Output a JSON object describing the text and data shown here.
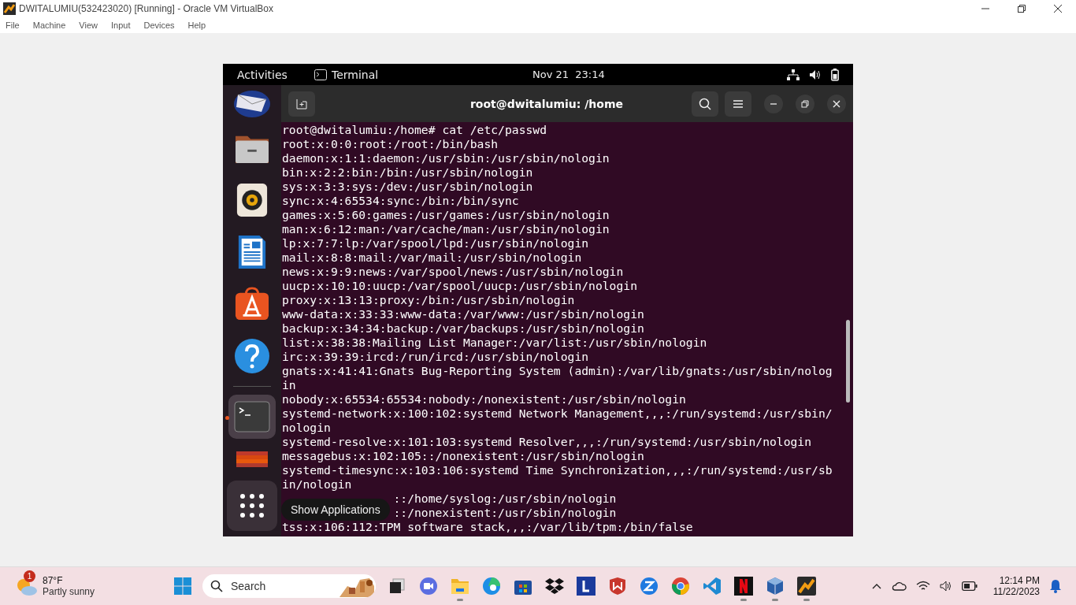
{
  "host_window": {
    "title": "DWITALUMIU(532423020) [Running] - Oracle VM VirtualBox",
    "menu": [
      "File",
      "Machine",
      "View",
      "Input",
      "Devices",
      "Help"
    ]
  },
  "guest": {
    "top_bar": {
      "activities": "Activities",
      "app": "Terminal",
      "clock": "Nov 21  23:14"
    },
    "dock": {
      "items": [
        {
          "kind": "mail",
          "active": false
        },
        {
          "kind": "files",
          "active": false
        },
        {
          "kind": "speaker",
          "active": false
        },
        {
          "kind": "document",
          "active": false
        },
        {
          "kind": "store",
          "active": false
        },
        {
          "kind": "help",
          "active": false
        },
        {
          "kind": "terminal",
          "active": true
        },
        {
          "kind": "stack",
          "active": false
        }
      ],
      "show_apps_tooltip": "Show Applications"
    },
    "terminal": {
      "title": "root@dwitalumiu: /home",
      "lines": [
        {
          "text": "root@dwitalumiu:/home# cat /etc/passwd",
          "covered": false
        },
        {
          "text": "root:x:0:0:root:/root:/bin/bash",
          "covered": false
        },
        {
          "text": "daemon:x:1:1:daemon:/usr/sbin:/usr/sbin/nologin",
          "covered": false
        },
        {
          "text": "bin:x:2:2:bin:/bin:/usr/sbin/nologin",
          "covered": false
        },
        {
          "text": "sys:x:3:3:sys:/dev:/usr/sbin/nologin",
          "covered": false
        },
        {
          "text": "sync:x:4:65534:sync:/bin:/bin/sync",
          "covered": false
        },
        {
          "text": "games:x:5:60:games:/usr/games:/usr/sbin/nologin",
          "covered": false
        },
        {
          "text": "man:x:6:12:man:/var/cache/man:/usr/sbin/nologin",
          "covered": false
        },
        {
          "text": "lp:x:7:7:lp:/var/spool/lpd:/usr/sbin/nologin",
          "covered": false
        },
        {
          "text": "mail:x:8:8:mail:/var/mail:/usr/sbin/nologin",
          "covered": false
        },
        {
          "text": "news:x:9:9:news:/var/spool/news:/usr/sbin/nologin",
          "covered": false
        },
        {
          "text": "uucp:x:10:10:uucp:/var/spool/uucp:/usr/sbin/nologin",
          "covered": false
        },
        {
          "text": "proxy:x:13:13:proxy:/bin:/usr/sbin/nologin",
          "covered": false
        },
        {
          "text": "www-data:x:33:33:www-data:/var/www:/usr/sbin/nologin",
          "covered": false
        },
        {
          "text": "backup:x:34:34:backup:/var/backups:/usr/sbin/nologin",
          "covered": false
        },
        {
          "text": "list:x:38:38:Mailing List Manager:/var/list:/usr/sbin/nologin",
          "covered": false
        },
        {
          "text": "irc:x:39:39:ircd:/run/ircd:/usr/sbin/nologin",
          "covered": false
        },
        {
          "text": "gnats:x:41:41:Gnats Bug-Reporting System (admin):/var/lib/gnats:/usr/sbin/nologin",
          "covered": false
        },
        {
          "text": "nobody:x:65534:65534:nobody:/nonexistent:/usr/sbin/nologin",
          "covered": false
        },
        {
          "text": "systemd-network:x:100:102:systemd Network Management,,,:/run/systemd:/usr/sbin/nologin",
          "covered": false
        },
        {
          "text": "systemd-resolve:x:101:103:systemd Resolver,,,:/run/systemd:/usr/sbin/nologin",
          "covered": false
        },
        {
          "text": "messagebus:x:102:105::/nonexistent:/usr/sbin/nologin",
          "covered": false
        },
        {
          "text": "systemd-timesync:x:103:106:systemd Time Synchronization,,,:/run/systemd:/usr/sbin/nologin",
          "covered": false
        },
        {
          "text": "::/home/syslog:/usr/sbin/nologin",
          "covered": true
        },
        {
          "text": "::/nonexistent:/usr/sbin/nologin",
          "covered": true
        },
        {
          "text": "tss:x:106:112:TPM software stack,,,:/var/lib/tpm:/bin/false",
          "covered": false
        }
      ]
    }
  },
  "taskbar": {
    "weather": {
      "badge": "1",
      "temperature": "87°F",
      "condition": "Partly sunny"
    },
    "search": {
      "placeholder": "Search"
    },
    "apps": [
      {
        "kind": "task-view",
        "running": false
      },
      {
        "kind": "meet",
        "running": false
      },
      {
        "kind": "folder",
        "running": true
      },
      {
        "kind": "edge",
        "running": false
      },
      {
        "kind": "store",
        "running": false
      },
      {
        "kind": "dropbox",
        "running": false
      },
      {
        "kind": "l-app",
        "running": false
      },
      {
        "kind": "shield",
        "running": false
      },
      {
        "kind": "z-app",
        "running": false
      },
      {
        "kind": "chrome",
        "running": false
      },
      {
        "kind": "vscode",
        "running": false
      },
      {
        "kind": "netflix",
        "running": true
      },
      {
        "kind": "cube",
        "running": true
      },
      {
        "kind": "gadget",
        "running": true
      }
    ],
    "clock": {
      "time": "12:14 PM",
      "date": "11/22/2023"
    }
  }
}
